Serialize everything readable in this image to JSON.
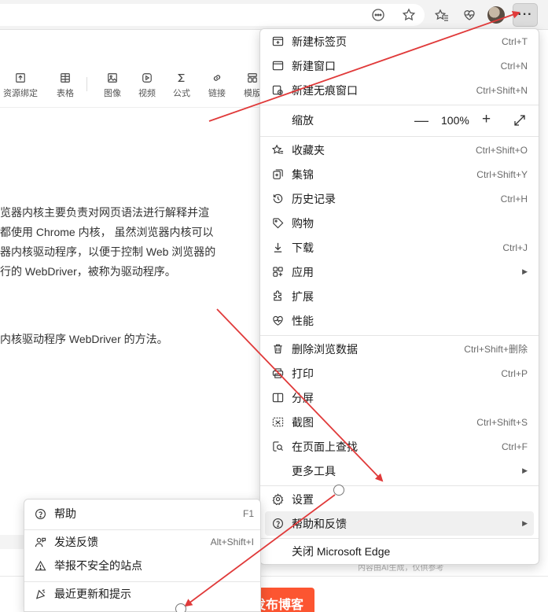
{
  "browser": {
    "more_label": "···"
  },
  "editor": {
    "toolbar": [
      {
        "label": "资源绑定",
        "icon": "upload-box-icon"
      },
      {
        "label": "表格",
        "icon": "table-icon"
      },
      {
        "label": "图像",
        "icon": "image-icon"
      },
      {
        "label": "视频",
        "icon": "video-icon"
      },
      {
        "label": "公式",
        "icon": "sigma-icon"
      },
      {
        "label": "链接",
        "icon": "link-icon"
      },
      {
        "label": "模版",
        "icon": "template-icon"
      }
    ],
    "paragraph_lines": [
      "览器内核主要负责对网页语法进行解释并渲",
      "都使用 Chrome 内核， 虽然浏览器内核可以",
      "器内核驱动程序，以便于控制 Web 浏览器的",
      "行的 WebDriver，被称为驱动程序。"
    ],
    "paragraph2": "内核驱动程序 WebDriver 的方法。",
    "ai_note": "内容由AI生成，仅供参考",
    "publish_label": "发布博客"
  },
  "menu": {
    "items": [
      {
        "label": "新建标签页",
        "shortcut": "Ctrl+T",
        "icon": "new-tab-icon"
      },
      {
        "label": "新建窗口",
        "shortcut": "Ctrl+N",
        "icon": "new-window-icon"
      },
      {
        "label": "新建无痕窗口",
        "shortcut": "Ctrl+Shift+N",
        "icon": "inprivate-window-icon"
      },
      {
        "label": "缩放",
        "icon": ""
      },
      {
        "label": "收藏夹",
        "shortcut": "Ctrl+Shift+O",
        "icon": "favorites-icon"
      },
      {
        "label": "集锦",
        "shortcut": "Ctrl+Shift+Y",
        "icon": "collections-icon"
      },
      {
        "label": "历史记录",
        "shortcut": "Ctrl+H",
        "icon": "history-icon"
      },
      {
        "label": "购物",
        "icon": "shopping-tag-icon"
      },
      {
        "label": "下载",
        "shortcut": "Ctrl+J",
        "icon": "download-icon"
      },
      {
        "label": "应用",
        "icon": "apps-icon"
      },
      {
        "label": "扩展",
        "icon": "extensions-icon"
      },
      {
        "label": "性能",
        "icon": "performance-heart-icon"
      },
      {
        "label": "删除浏览数据",
        "shortcut": "Ctrl+Shift+删除",
        "icon": "trash-icon"
      },
      {
        "label": "打印",
        "shortcut": "Ctrl+P",
        "icon": "print-icon"
      },
      {
        "label": "分屏",
        "icon": "split-screen-icon"
      },
      {
        "label": "截图",
        "shortcut": "Ctrl+Shift+S",
        "icon": "screenshot-icon"
      },
      {
        "label": "在页面上查找",
        "shortcut": "Ctrl+F",
        "icon": "find-on-page-icon"
      },
      {
        "label": "更多工具",
        "icon": ""
      },
      {
        "label": "设置",
        "icon": "settings-gear-icon"
      },
      {
        "label": "帮助和反馈",
        "icon": "help-circle-icon"
      },
      {
        "label": "关闭 Microsoft Edge",
        "icon": ""
      }
    ],
    "zoom": {
      "minus": "—",
      "value": "100%",
      "plus": "+"
    }
  },
  "submenu": {
    "items": [
      {
        "label": "帮助",
        "shortcut": "F1",
        "icon": "help-circle-icon"
      },
      {
        "label": "发送反馈",
        "shortcut": "Alt+Shift+I",
        "icon": "feedback-icon"
      },
      {
        "label": "举报不安全的站点",
        "icon": "warning-icon"
      },
      {
        "label": "最近更新和提示",
        "icon": "whats-new-icon"
      }
    ]
  },
  "colors": {
    "annotation_red": "#e03a3a",
    "publish_orange": "#fc5531",
    "menu_highlight": "#f0f0f0"
  }
}
